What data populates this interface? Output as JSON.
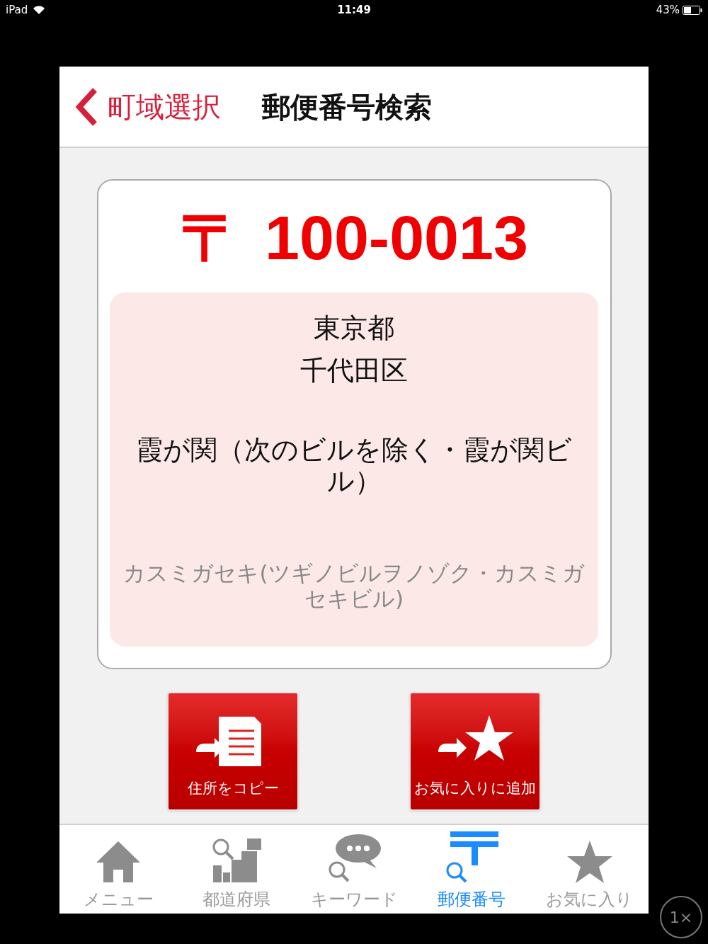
{
  "status_bar": {
    "device": "iPad",
    "time": "11:49",
    "battery": "43%"
  },
  "nav": {
    "back": "町域選択",
    "title": "郵便番号検索"
  },
  "result": {
    "mark": "〒",
    "postal_code": "100-0013",
    "prefecture": "東京都",
    "city": "千代田区",
    "town": "霞が関（次のビルを除く・霞が関ビル）",
    "kana": "カスミガセキ(ツギノビルヲノゾク・カスミガセキビル)"
  },
  "actions": [
    {
      "kind": "copy",
      "label": "住所をコピー"
    },
    {
      "kind": "favorite",
      "label": "お気に入りに追加"
    }
  ],
  "tabs": [
    {
      "kind": "home",
      "label": "メニュー",
      "selected": false
    },
    {
      "kind": "map",
      "label": "都道府県",
      "selected": false
    },
    {
      "kind": "keyword",
      "label": "キーワード",
      "selected": false
    },
    {
      "kind": "postal",
      "label": "郵便番号",
      "selected": true
    },
    {
      "kind": "star",
      "label": "お気に入り",
      "selected": false
    }
  ],
  "zoom_badge": "1×"
}
